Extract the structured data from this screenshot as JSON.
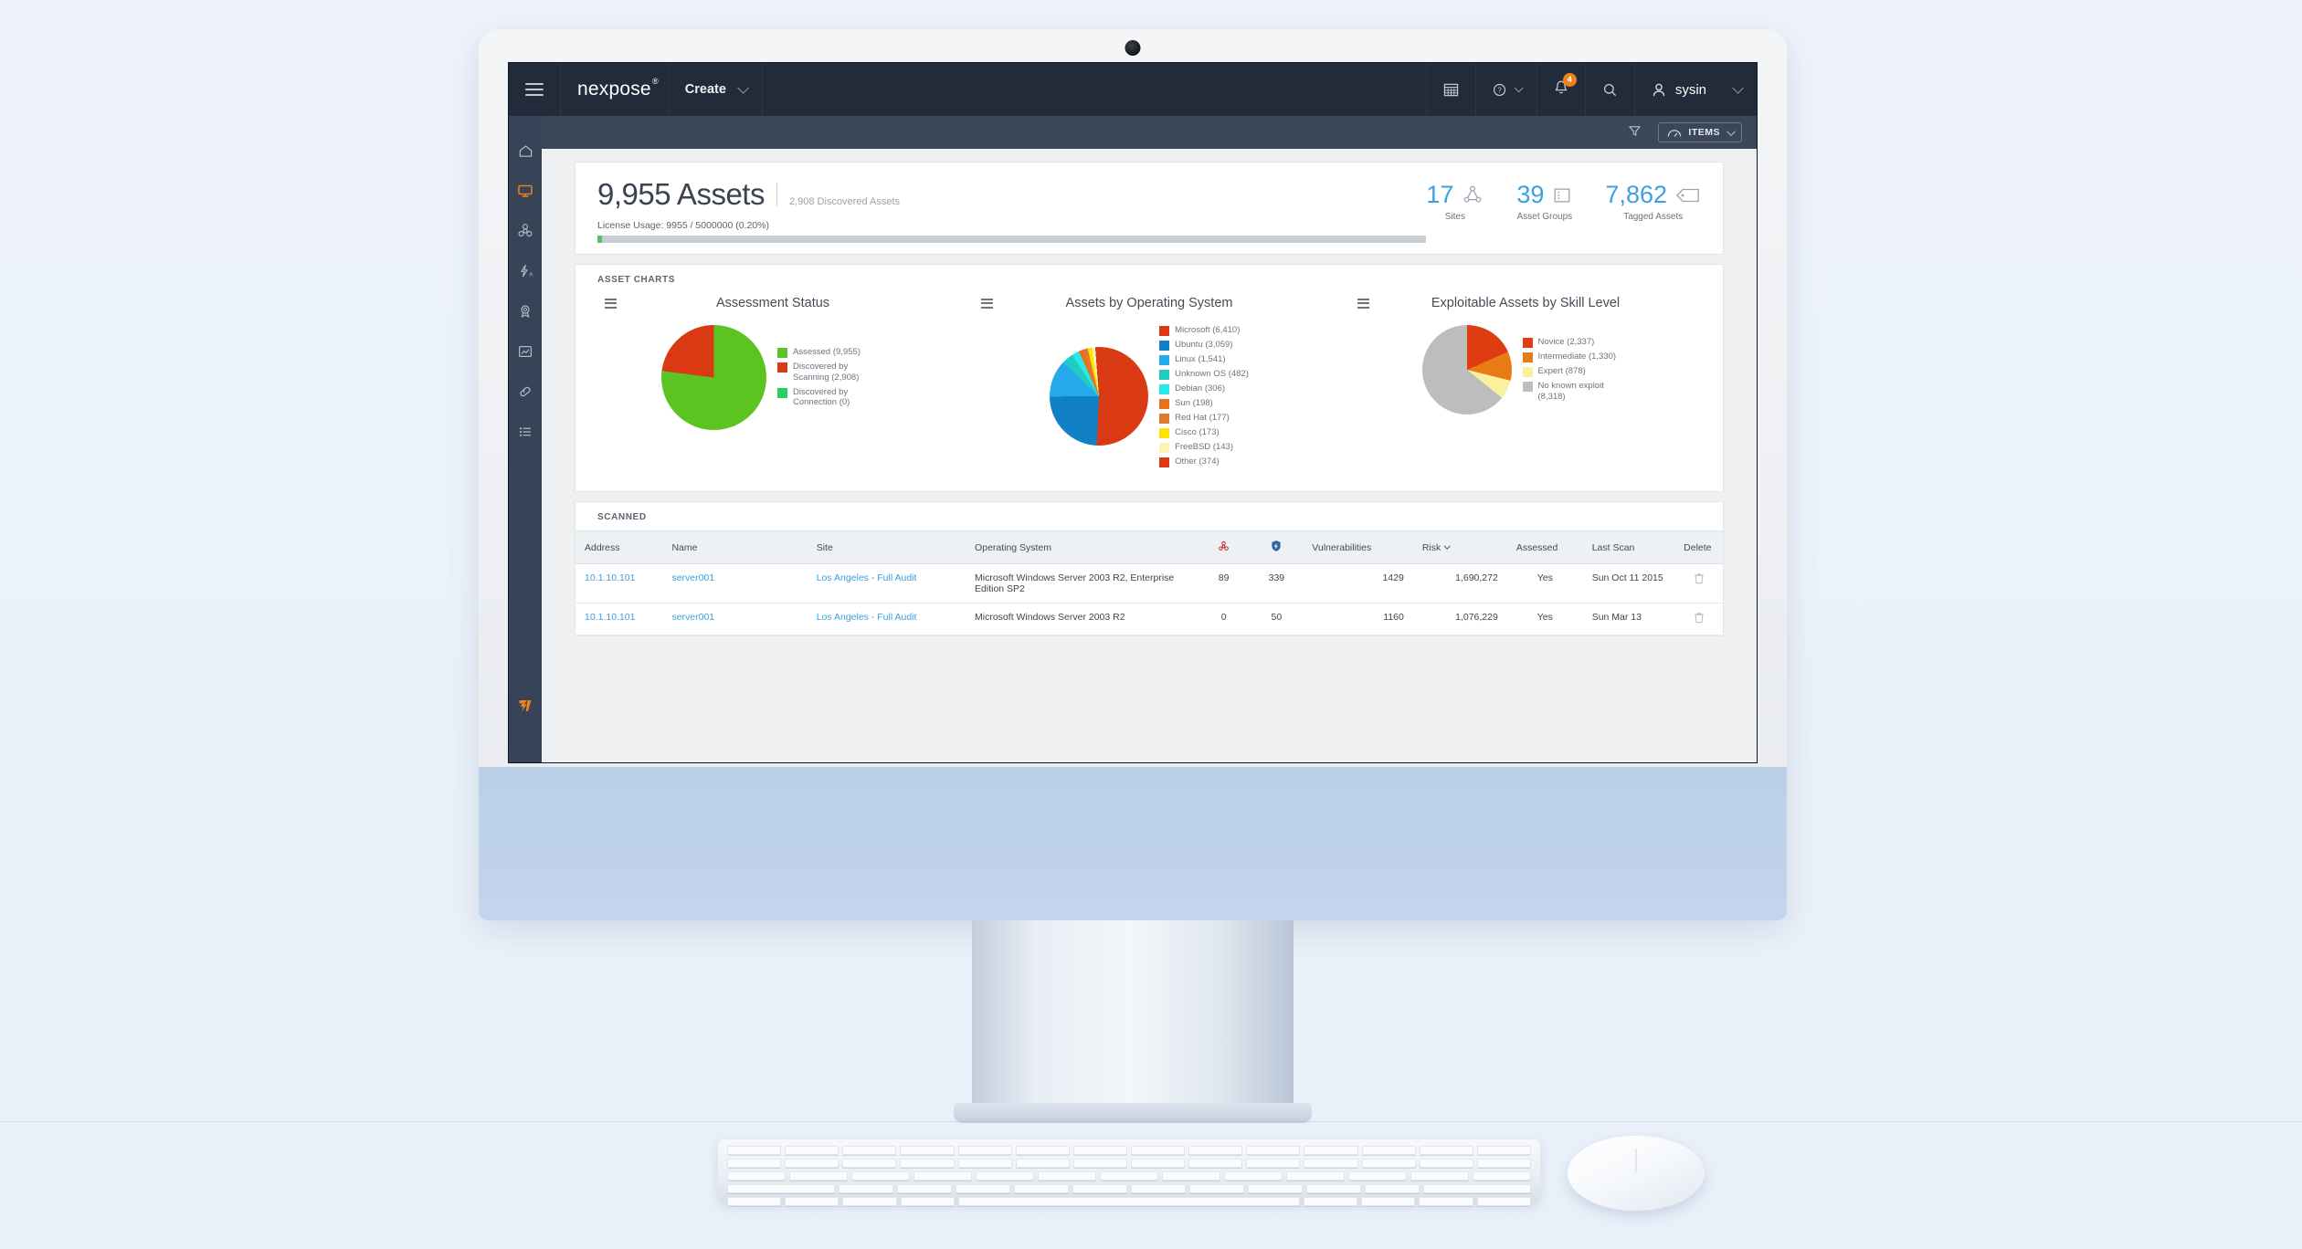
{
  "topbar": {
    "menu_icon": "hamburger-icon",
    "brand": "nexpose",
    "brand_mark": "®",
    "create_label": "Create",
    "calendar_icon": "calendar-icon",
    "help_icon": "help-icon",
    "notifications_icon": "bell-icon",
    "notification_count": "4",
    "search_icon": "search-icon",
    "user_icon": "user-icon",
    "username": "sysin"
  },
  "rail": {
    "items": [
      {
        "name": "home",
        "icon": "home-icon",
        "active": false
      },
      {
        "name": "assets",
        "icon": "monitor-icon",
        "active": true
      },
      {
        "name": "vulnerabilities",
        "icon": "biohazard-icon",
        "active": false
      },
      {
        "name": "policies",
        "icon": "lightning-a-icon",
        "active": false
      },
      {
        "name": "scan-templates",
        "icon": "award-icon",
        "active": false
      },
      {
        "name": "reports",
        "icon": "chart-box-icon",
        "active": false
      },
      {
        "name": "tickets",
        "icon": "capsule-icon",
        "active": false
      },
      {
        "name": "administration",
        "icon": "list-icon",
        "active": false
      }
    ],
    "logo": "rapid7-logo",
    "logo_color": "#f0821e"
  },
  "toolbar": {
    "filter_icon": "funnel-icon",
    "items_icon": "gauge-icon",
    "items_label": "ITEMS",
    "items_chevron": "chevron-down-icon"
  },
  "summary": {
    "assets_count": "9,955 Assets",
    "discovered": "2,908 Discovered Assets",
    "license_usage": "License Usage: 9955 / 5000000 (0.20%)",
    "license_percent": 0.2,
    "stats": [
      {
        "value": "17",
        "label": "Sites",
        "icon": "sites-icon"
      },
      {
        "value": "39",
        "label": "Asset Groups",
        "icon": "asset-groups-icon"
      },
      {
        "value": "7,862",
        "label": "Tagged Assets",
        "icon": "tag-icon"
      }
    ]
  },
  "charts_section": {
    "title": "ASSET CHARTS",
    "menu_icon": "chart-menu-icon"
  },
  "table_section": {
    "title": "SCANNED"
  },
  "chart_data": [
    {
      "type": "pie",
      "title": "Assessment Status",
      "categories": [
        "Assessed (9,955)",
        "Discovered by Scanning (2,908)",
        "Discovered by Connection (0)"
      ],
      "values": [
        9955,
        2908,
        0
      ],
      "display_shares": [
        77,
        23,
        0
      ],
      "colors": [
        "#5cc422",
        "#d93a14",
        "#27cf5e"
      ],
      "legend": "right"
    },
    {
      "type": "pie",
      "title": "Assets by Operating System",
      "categories": [
        "Microsoft (6,410)",
        "Ubuntu (3,059)",
        "Linux (1,541)",
        "Unknown OS (482)",
        "Debian (306)",
        "Sun (198)",
        "Red Hat (177)",
        "Cisco (173)",
        "FreeBSD (143)",
        "Other (374)"
      ],
      "values": [
        6410,
        3059,
        1541,
        482,
        306,
        198,
        177,
        173,
        143,
        374
      ],
      "display_shares": [
        50.7,
        24.2,
        12.2,
        3.8,
        2.4,
        1.6,
        1.4,
        1.4,
        1.1,
        1.2
      ],
      "colors": [
        "#d93a14",
        "#1180c4",
        "#26a9ea",
        "#20ccc4",
        "#2ae8e8",
        "#e8721c",
        "#e07a33",
        "#ffe400",
        "#fdf3b4",
        "#d93a14"
      ],
      "legend": "right"
    },
    {
      "type": "pie",
      "title": "Exploitable Assets by Skill Level",
      "categories": [
        "Novice (2,337)",
        "Intermediate (1,330)",
        "Expert (878)",
        "No known exploit (8,318)"
      ],
      "values": [
        2337,
        1330,
        878,
        8318
      ],
      "display_shares": [
        18.4,
        10.5,
        6.9,
        64.2
      ],
      "colors": [
        "#de3c11",
        "#e87b15",
        "#faf0a0",
        "#bdbdbd"
      ],
      "legend": "right"
    }
  ],
  "table": {
    "columns": [
      {
        "label": "Address",
        "key": "address"
      },
      {
        "label": "Name",
        "key": "name"
      },
      {
        "label": "Site",
        "key": "site"
      },
      {
        "label": "Operating System",
        "key": "os"
      },
      {
        "label": "",
        "key": "malware",
        "icon": "biohazard-icon"
      },
      {
        "label": "",
        "key": "exploits",
        "icon": "shield-exploit-icon"
      },
      {
        "label": "Vulnerabilities",
        "key": "vulns"
      },
      {
        "label": "Risk",
        "key": "risk",
        "sorted": "desc"
      },
      {
        "label": "Assessed",
        "key": "assessed"
      },
      {
        "label": "Last Scan",
        "key": "last_scan"
      },
      {
        "label": "Delete",
        "key": "delete",
        "icon": "trash-icon"
      }
    ],
    "rows": [
      {
        "address": "10.1.10.101",
        "name": "server001",
        "site": "Los Angeles - Full Audit",
        "os": "Microsoft Windows Server 2003 R2, Enterprise Edition SP2",
        "malware": "89",
        "exploits": "339",
        "vulns": "1429",
        "risk": "1,690,272",
        "assessed": "Yes",
        "last_scan": "Sun Oct 11 2015",
        "delete": "trash-icon"
      },
      {
        "address": "10.1.10.101",
        "name": "server001",
        "site": "Los Angeles - Full Audit",
        "os": "Microsoft Windows Server 2003 R2",
        "malware": "0",
        "exploits": "50",
        "vulns": "1160",
        "risk": "1,076,229",
        "assessed": "Yes",
        "last_scan": "Sun Mar 13",
        "delete": "trash-icon"
      }
    ]
  }
}
